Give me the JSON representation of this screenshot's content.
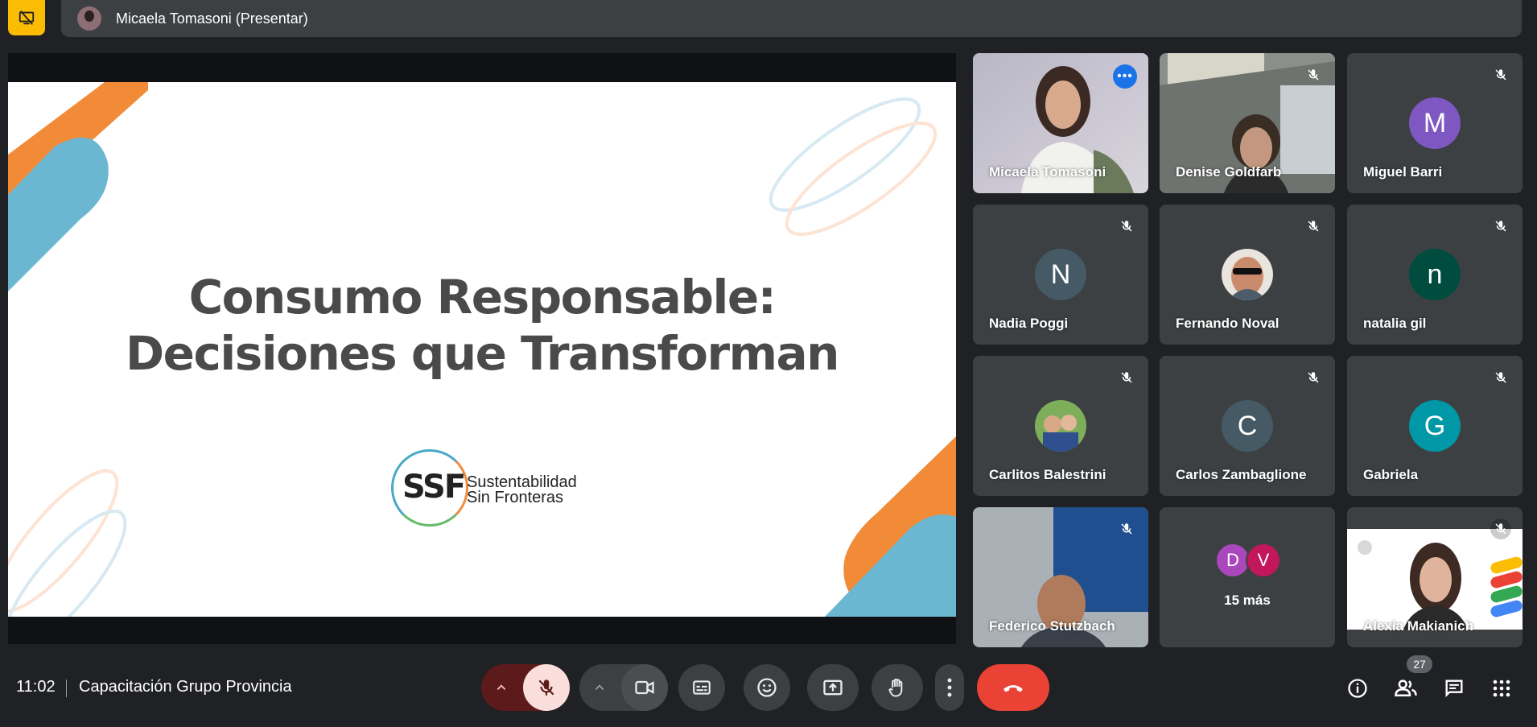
{
  "presenter_bar": {
    "name": "Micaela Tomasoni (Presentar)"
  },
  "slide": {
    "title_line1": "Consumo Responsable:",
    "title_line2": "Decisiones que Transforman",
    "logo_mark": "SSF",
    "logo_line1": "Sustentabilidad",
    "logo_line2": "Sin Fronteras"
  },
  "participants": [
    {
      "name": "Micaela Tomasoni",
      "type": "video"
    },
    {
      "name": "Denise Goldfarb",
      "type": "video"
    },
    {
      "name": "Miguel Barri",
      "letter": "M",
      "color": "#7e57c2"
    },
    {
      "name": "Nadia Poggi",
      "letter": "N",
      "color": "#455a64"
    },
    {
      "name": "Fernando Noval",
      "type": "photo"
    },
    {
      "name": "natalia gil",
      "letter": "n",
      "color": "#004d40"
    },
    {
      "name": "Carlitos Balestrini",
      "type": "photo"
    },
    {
      "name": "Carlos Zambaglione",
      "letter": "C",
      "color": "#455a64"
    },
    {
      "name": "Gabriela",
      "letter": "G",
      "color": "#0097a7"
    },
    {
      "name": "Federico Stutzbach",
      "type": "video"
    },
    {
      "name": "Alexia Makianich",
      "type": "video"
    }
  ],
  "overflow_tile": {
    "label": "15 más",
    "avatars": [
      {
        "letter": "D",
        "color": "#ab47bc"
      },
      {
        "letter": "V",
        "color": "#c2185b"
      }
    ]
  },
  "bottom_bar": {
    "time": "11:02",
    "meeting_title": "Capacitación Grupo Provincia",
    "participant_count": "27"
  },
  "colors": {
    "background": "#202124",
    "tile": "#3c4043",
    "stop_presenting": "#fbbc04",
    "end_call": "#ea4335",
    "mic_muted": "#f9dedc",
    "active_speaker_border": "#8ab4f8"
  }
}
